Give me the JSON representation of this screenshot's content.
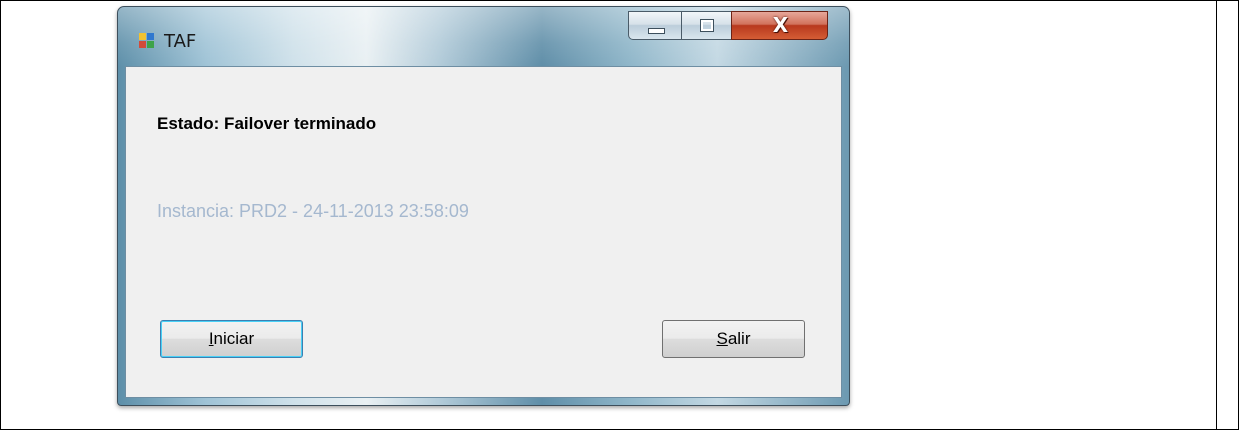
{
  "window": {
    "title": "TAF",
    "icon": "app-window-icon"
  },
  "caption": {
    "minimize_icon": "minimize-icon",
    "maximize_icon": "maximize-icon",
    "close_glyph": "X"
  },
  "content": {
    "status": "Estado: Failover terminado",
    "instance": "Instancia: PRD2 - 24-11-2013 23:58:09"
  },
  "buttons": {
    "start": {
      "accel": "I",
      "rest": "niciar"
    },
    "exit": {
      "accel": "S",
      "rest": "alir"
    }
  },
  "colors": {
    "instance_text": "#a5b8cf",
    "focus_border": "#3c7fb1",
    "close_button": "#c84e2e"
  }
}
